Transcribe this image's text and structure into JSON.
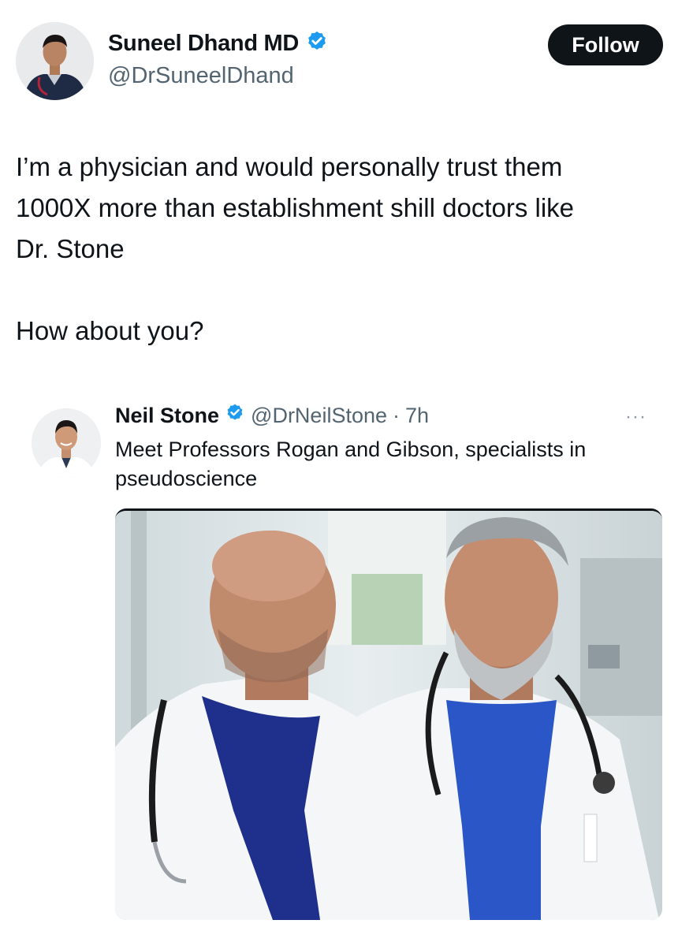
{
  "author": {
    "name": "Suneel Dhand MD",
    "handle": "@DrSuneelDhand",
    "verified_icon": "verified-badge-icon"
  },
  "follow_label": "Follow",
  "tweet": {
    "text": "I’m a physician and would personally trust them\n1000X more than establishment shill doctors like\nDr. Stone\n\nHow about you?"
  },
  "quote": {
    "name": "Neil Stone",
    "handle": "@DrNeilStone",
    "separator": "·",
    "time": "7h",
    "more": "···",
    "text": "Meet Professors Rogan and Gibson, specialists in\npseudoscience"
  },
  "colors": {
    "verified": "#1d9bf0",
    "handle": "#536471",
    "follow_bg": "#0f1419",
    "scrubs": "#2a56c8"
  }
}
